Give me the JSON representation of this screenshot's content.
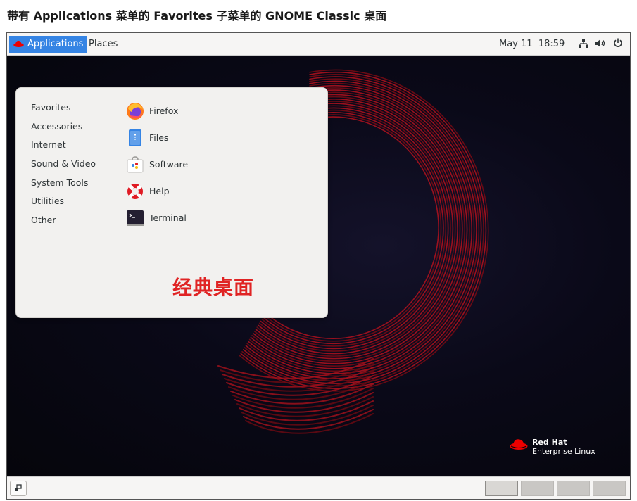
{
  "caption": "带有 Applications 菜单的 Favorites 子菜单的 GNOME Classic 桌面",
  "topbar": {
    "applications_label": "Applications",
    "places_label": "Places",
    "clock": "May 11  18:59"
  },
  "menu": {
    "categories": [
      "Favorites",
      "Accessories",
      "Internet",
      "Sound & Video",
      "System Tools",
      "Utilities",
      "Other"
    ],
    "apps": [
      {
        "label": "Firefox",
        "icon": "firefox-icon"
      },
      {
        "label": "Files",
        "icon": "files-icon"
      },
      {
        "label": "Software",
        "icon": "software-icon"
      },
      {
        "label": "Help",
        "icon": "help-icon"
      },
      {
        "label": "Terminal",
        "icon": "terminal-icon"
      }
    ]
  },
  "overlay_label": "经典桌面",
  "branding": {
    "line1": "Red Hat",
    "line2": "Enterprise Linux"
  },
  "workspaces": {
    "count": 4,
    "active_index": 0
  },
  "colors": {
    "accent": "#3584e4",
    "overlay_red": "#e02424",
    "brand_red": "#ee0000"
  }
}
